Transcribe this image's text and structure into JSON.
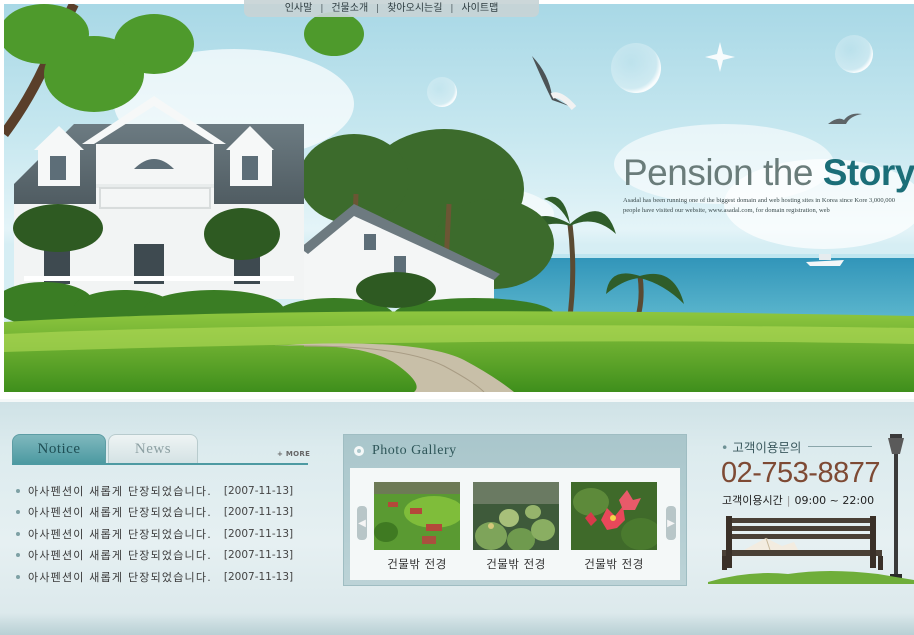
{
  "topnav": {
    "items": [
      "인사말",
      "건물소개",
      "찾아오시는길",
      "사이트맵"
    ],
    "separator": "|"
  },
  "hero": {
    "title_light": "Pension the ",
    "title_strong": "Story",
    "subtitle": "Asadal has been running one of the biggest domain and web hosting sites in Korea since Kore 3,000,000 people have visited our website, www.asadal.com, for domain registration, web"
  },
  "notice": {
    "tab_active": "Notice",
    "tab_inactive": "News",
    "more_label": "+ MORE",
    "items": [
      {
        "title": "아사펜션이 새롭게 단장되었습니다.",
        "date": "[2007-11-13]"
      },
      {
        "title": "아사펜션이 새롭게 단장되었습니다.",
        "date": "[2007-11-13]"
      },
      {
        "title": "아사펜션이 새롭게 단장되었습니다.",
        "date": "[2007-11-13]"
      },
      {
        "title": "아사펜션이 새롭게 단장되었습니다.",
        "date": "[2007-11-13]"
      },
      {
        "title": "아사펜션이 새롭게 단장되었습니다.",
        "date": "[2007-11-13]"
      }
    ]
  },
  "gallery": {
    "title": "Photo Gallery",
    "photos": [
      {
        "caption": "건물밖 전경",
        "icon": "garden-photo"
      },
      {
        "caption": "건물밖 전경",
        "icon": "cactus-photo"
      },
      {
        "caption": "건물밖 전경",
        "icon": "flower-photo"
      }
    ]
  },
  "contact": {
    "label": "고객이용문의",
    "phone": "02-753-8877",
    "hours_label": "고객이용시간",
    "hours_value": "09:00 ~ 22:00",
    "hours_sep": "|"
  },
  "colors": {
    "accent": "#1b6e78",
    "phone": "#7e4a34",
    "tab_active": "#4d9aa2"
  }
}
